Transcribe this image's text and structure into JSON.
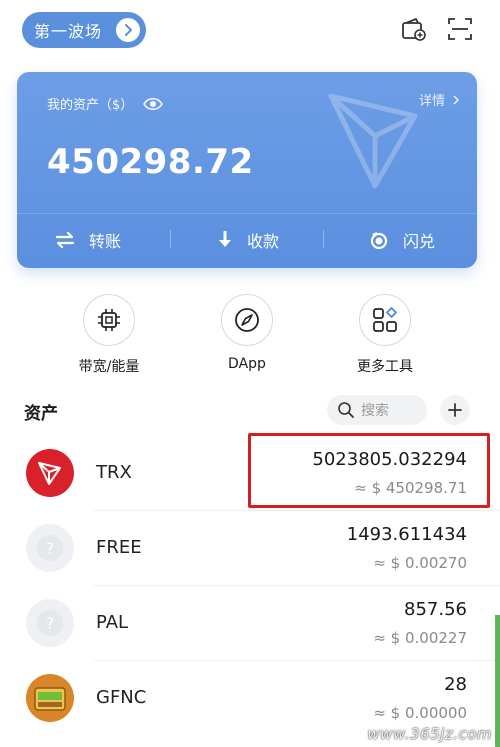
{
  "topbar": {
    "square_label": "第一波场",
    "icons": [
      "wallet-add-icon",
      "scan-icon"
    ]
  },
  "card": {
    "label": "我的资产（$）",
    "detail": "详情",
    "total": "450298.72",
    "actions": [
      {
        "label": "转账",
        "icon": "transfer-icon"
      },
      {
        "label": "收款",
        "icon": "receive-icon"
      },
      {
        "label": "闪兑",
        "icon": "swap-icon"
      }
    ],
    "colors": {
      "card": "#5b8fdf",
      "accent": "#5a8fdc"
    }
  },
  "tools": [
    {
      "label": "带宽/能量",
      "icon": "chip-icon"
    },
    {
      "label": "DApp",
      "icon": "compass-icon"
    },
    {
      "label": "更多工具",
      "icon": "grid-icon"
    }
  ],
  "assets": {
    "title": "资产",
    "search_placeholder": "搜索",
    "rows": [
      {
        "name": "TRX",
        "amount": "5023805.032294",
        "usd": "≈ $ 450298.71"
      },
      {
        "name": "FREE",
        "amount": "1493.611434",
        "usd": "≈ $ 0.00270"
      },
      {
        "name": "PAL",
        "amount": "857.56",
        "usd": "≈ $ 0.00227"
      },
      {
        "name": "GFNC",
        "amount": "28",
        "usd": "≈ $ 0.00000"
      }
    ]
  },
  "watermark": "www.365jz.com",
  "colors": {
    "highlight": "#d62020",
    "trx": "#d9212b"
  }
}
